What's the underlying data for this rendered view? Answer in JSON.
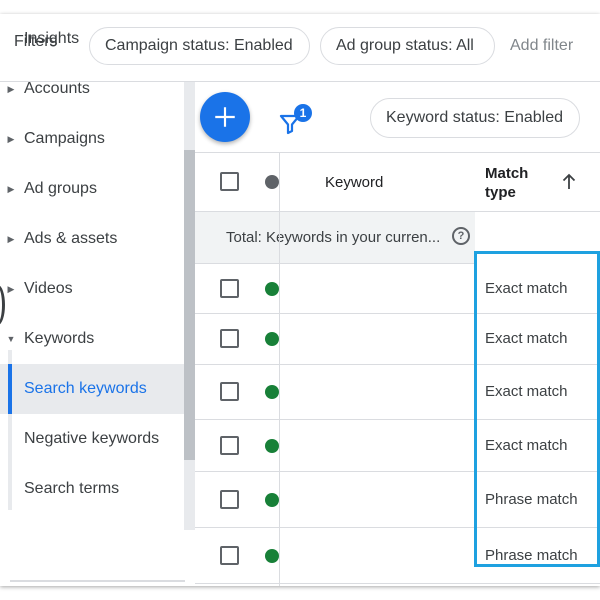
{
  "filter_bar": {
    "label": "Filters",
    "chips": [
      "Campaign status: Enabled",
      "Ad group status: All"
    ],
    "add_filter": "Add filter"
  },
  "sidebar": {
    "items": [
      {
        "label": "Insights",
        "expandable": false
      },
      {
        "label": "Accounts",
        "expandable": true
      },
      {
        "label": "Campaigns",
        "expandable": true
      },
      {
        "label": "Ad groups",
        "expandable": true
      },
      {
        "label": "Ads & assets",
        "expandable": true
      },
      {
        "label": "Videos",
        "expandable": true
      },
      {
        "label": "Keywords",
        "expandable": true,
        "expanded": true
      },
      {
        "label": "Search keywords",
        "active": true
      },
      {
        "label": "Negative keywords"
      },
      {
        "label": "Search terms"
      }
    ]
  },
  "toolbar": {
    "add_icon": "plus-icon",
    "filter_icon": "filter-funnel-icon",
    "filter_badge": "1",
    "keyword_status_chip": "Keyword status: Enabled"
  },
  "table": {
    "columns": {
      "keyword": "Keyword",
      "match_type": "Match type",
      "sort": "ascending"
    },
    "total_row": "Total: Keywords in your curren...",
    "rows": [
      {
        "status": "enabled",
        "match_type": "Exact match"
      },
      {
        "status": "enabled",
        "match_type": "Exact match"
      },
      {
        "status": "enabled",
        "match_type": "Exact match"
      },
      {
        "status": "enabled",
        "match_type": "Exact match"
      },
      {
        "status": "enabled",
        "match_type": "Phrase match"
      },
      {
        "status": "enabled",
        "match_type": "Phrase match"
      }
    ]
  },
  "colors": {
    "accent": "#1a73e8",
    "status_enabled": "#188038",
    "highlight": "#1ea1e0"
  }
}
